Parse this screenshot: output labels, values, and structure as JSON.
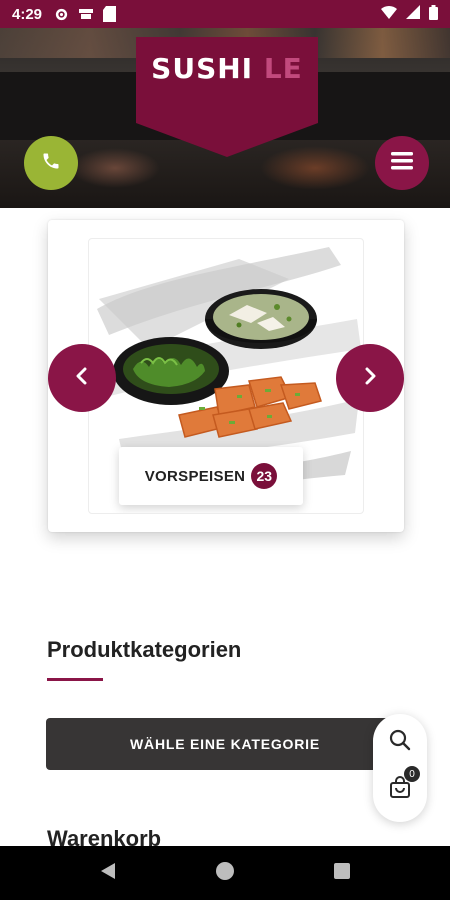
{
  "status_bar": {
    "time": "4:29"
  },
  "header": {
    "logo_main": "SUSHI",
    "logo_accent": "LE"
  },
  "carousel": {
    "category_label": "VORSPEISEN",
    "category_count": "23"
  },
  "section": {
    "title": "Produktkategorien",
    "select_label": "WÄHLE EINE KATEGORIE"
  },
  "cart": {
    "title": "Warenkorb",
    "badge": "0"
  },
  "colors": {
    "brand": "#8a1547",
    "status_bar": "#7a0f3a",
    "call": "#9ab535",
    "dark_button": "#373535"
  },
  "icons": [
    "phone-icon",
    "menu-icon",
    "chevron-left-icon",
    "chevron-right-icon",
    "search-icon",
    "shopping-bag-icon",
    "back-icon",
    "home-icon",
    "recents-icon"
  ]
}
